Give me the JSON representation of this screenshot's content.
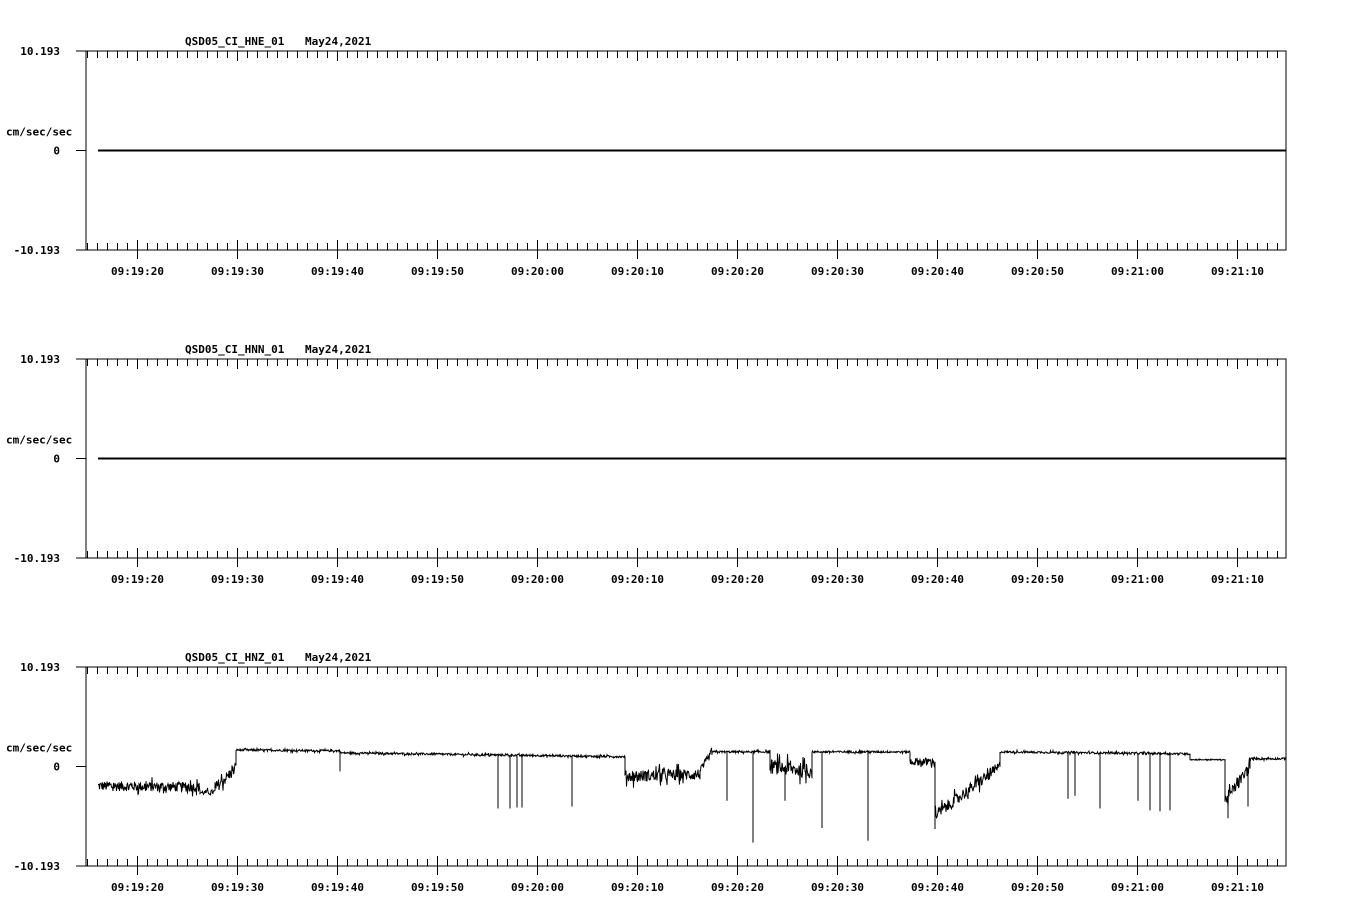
{
  "chart_data": [
    {
      "type": "line",
      "title": "QSD05_CI_HNE_01",
      "date": "May24,2021",
      "ylabel": "cm/sec/sec",
      "ylim": [
        -10.193,
        10.193
      ],
      "yticks": [
        "10.193",
        "0",
        "-10.193"
      ],
      "x_unit": "seconds after 09:19:00",
      "xlim": [
        14.9,
        134.9
      ],
      "xtick_labels": [
        "09:19:20",
        "09:19:30",
        "09:19:40",
        "09:19:50",
        "09:20:00",
        "09:20:10",
        "09:20:20",
        "09:20:30",
        "09:20:40",
        "09:20:50",
        "09:21:00",
        "09:21:10"
      ],
      "segments": [
        [
          16.1,
          134.9,
          0,
          0,
          0
        ]
      ],
      "spikes": []
    },
    {
      "type": "line",
      "title": "QSD05_CI_HNN_01",
      "date": "May24,2021",
      "ylabel": "cm/sec/sec",
      "ylim": [
        -10.193,
        10.193
      ],
      "yticks": [
        "10.193",
        "0",
        "-10.193"
      ],
      "x_unit": "seconds after 09:19:00",
      "xlim": [
        14.9,
        134.9
      ],
      "xtick_labels": [
        "09:19:20",
        "09:19:30",
        "09:19:40",
        "09:19:50",
        "09:20:00",
        "09:20:10",
        "09:20:20",
        "09:20:30",
        "09:20:40",
        "09:20:50",
        "09:21:00",
        "09:21:10"
      ],
      "segments": [
        [
          16.1,
          134.9,
          0,
          0,
          0
        ]
      ],
      "spikes": []
    },
    {
      "type": "line",
      "title": "QSD05_CI_HNZ_01",
      "date": "May24,2021",
      "ylabel": "cm/sec/sec",
      "ylim": [
        -10.193,
        10.193
      ],
      "yticks": [
        "10.193",
        "0",
        "-10.193"
      ],
      "x_unit": "seconds after 09:19:00",
      "xlim": [
        14.9,
        134.9
      ],
      "xtick_labels": [
        "09:19:20",
        "09:19:30",
        "09:19:40",
        "09:19:50",
        "09:20:00",
        "09:20:10",
        "09:20:20",
        "09:20:30",
        "09:20:40",
        "09:20:50",
        "09:21:00",
        "09:21:10"
      ],
      "segments_format": "[t_start, t_end, value_start, value_end, noise_amplitude]",
      "segments": [
        [
          16.1,
          26.3,
          -2.0,
          -2.1,
          1.0
        ],
        [
          26.3,
          27.8,
          -2.7,
          -2.6,
          0.5
        ],
        [
          27.8,
          29.9,
          -2.2,
          -0.2,
          1.2
        ],
        [
          29.9,
          40.3,
          1.7,
          1.6,
          0.2
        ],
        [
          40.3,
          68.8,
          1.4,
          1.0,
          0.2
        ],
        [
          68.8,
          76.3,
          -1.0,
          -0.8,
          1.2
        ],
        [
          76.3,
          77.5,
          -0.5,
          1.5,
          0.8
        ],
        [
          77.5,
          83.3,
          1.5,
          1.5,
          0.2
        ],
        [
          83.3,
          87.5,
          0.0,
          -0.5,
          1.5
        ],
        [
          87.5,
          97.3,
          1.5,
          1.5,
          0.2
        ],
        [
          97.3,
          99.8,
          0.5,
          0.5,
          0.8
        ],
        [
          99.8,
          106.3,
          -5.0,
          0.0,
          1.2
        ],
        [
          106.3,
          125.3,
          1.5,
          1.3,
          0.2
        ],
        [
          125.3,
          128.8,
          0.7,
          0.7,
          0.1
        ],
        [
          128.8,
          131.3,
          -3.5,
          0.0,
          1.2
        ],
        [
          131.3,
          134.9,
          0.8,
          0.8,
          0.2
        ]
      ],
      "spikes": [
        [
          40.3,
          -0.5
        ],
        [
          56.1,
          -4.3
        ],
        [
          57.3,
          -4.3
        ],
        [
          58.0,
          -4.2
        ],
        [
          58.5,
          -4.2
        ],
        [
          63.5,
          -4.1
        ],
        [
          79.0,
          -3.5
        ],
        [
          81.6,
          -7.8
        ],
        [
          84.8,
          -3.5
        ],
        [
          88.5,
          -6.3
        ],
        [
          93.1,
          -7.6
        ],
        [
          99.8,
          -6.4
        ],
        [
          113.1,
          -3.3
        ],
        [
          113.8,
          -3.0
        ],
        [
          116.3,
          -4.3
        ],
        [
          120.1,
          -3.5
        ],
        [
          121.3,
          -4.5
        ],
        [
          122.3,
          -4.6
        ],
        [
          123.3,
          -4.5
        ],
        [
          129.1,
          -5.3
        ],
        [
          131.1,
          -4.1
        ]
      ]
    }
  ]
}
